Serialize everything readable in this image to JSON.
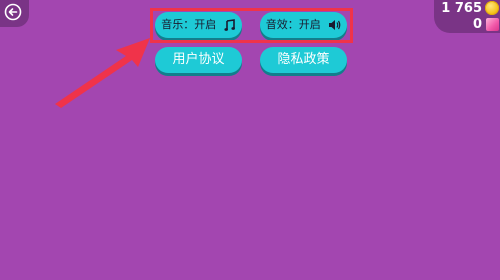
{
  "currency": {
    "coins": "1 765",
    "gems": "0",
    "coin_icon": "coin-icon",
    "gem_icon": "gem-icon"
  },
  "settings": {
    "music_label": "音乐：开启",
    "music_icon": "music-note-icon",
    "sfx_label": "音效：开启",
    "sfx_icon": "speaker-icon",
    "terms_label": "用户协议",
    "privacy_label": "隐私政策"
  },
  "colors": {
    "background": "#a346b0",
    "button": "#1ecad6",
    "highlight": "#f0334a"
  }
}
